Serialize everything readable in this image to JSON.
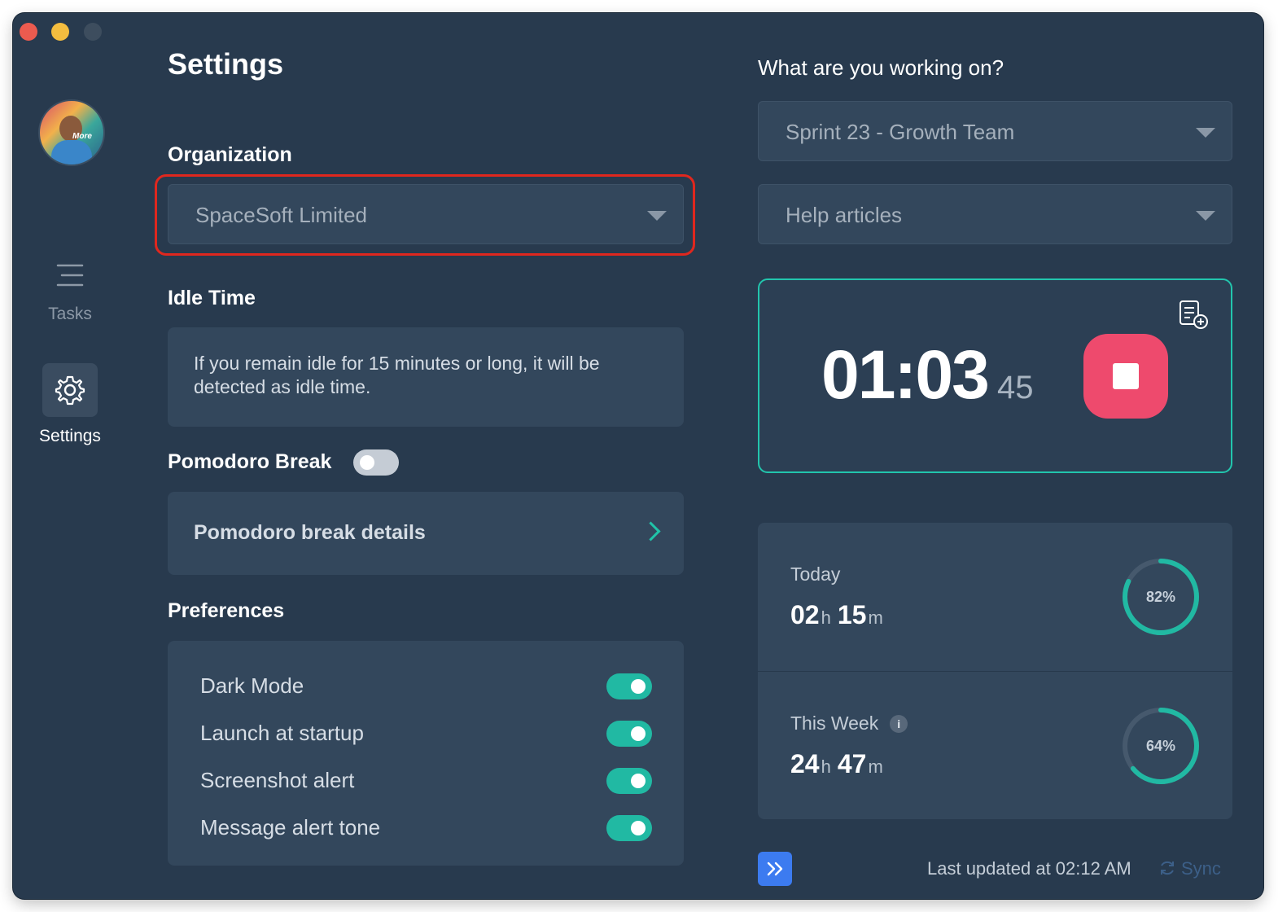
{
  "window": {
    "controls": [
      "close",
      "minimize",
      "disabled"
    ]
  },
  "sidebar": {
    "avatar_tag": "More",
    "items": [
      {
        "label": "Tasks",
        "icon": "list-icon",
        "active": false
      },
      {
        "label": "Settings",
        "icon": "gear-icon",
        "active": true
      }
    ]
  },
  "settings": {
    "title": "Settings",
    "organization": {
      "label": "Organization",
      "value": "SpaceSoft Limited"
    },
    "idle_time": {
      "label": "Idle Time",
      "text": "If you remain idle for 15 minutes or long, it will be detected as idle time."
    },
    "pomodoro": {
      "label": "Pomodoro Break",
      "enabled": false,
      "details_label": "Pomodoro break details"
    },
    "preferences": {
      "label": "Preferences",
      "items": [
        {
          "label": "Dark Mode",
          "enabled": true
        },
        {
          "label": "Launch at startup",
          "enabled": true
        },
        {
          "label": "Screenshot alert",
          "enabled": true
        },
        {
          "label": "Message alert tone",
          "enabled": true
        }
      ]
    }
  },
  "tracker": {
    "prompt": "What are you working on?",
    "project": "Sprint 23 - Growth Team",
    "task": "Help articles",
    "timer": {
      "main": "01:03",
      "seconds": "45"
    },
    "stats": [
      {
        "label": "Today",
        "hours": "02",
        "hours_unit": "h",
        "minutes": "15",
        "minutes_unit": "m",
        "percent": 82,
        "percent_label": "82%"
      },
      {
        "label": "This Week",
        "hours": "24",
        "hours_unit": "h",
        "minutes": "47",
        "minutes_unit": "m",
        "percent": 64,
        "percent_label": "64%",
        "info": "i"
      }
    ],
    "last_updated": "Last updated at 02:12 AM",
    "sync_label": "Sync"
  },
  "colors": {
    "background": "#283a4e",
    "panel": "#33475c",
    "accent": "#21b9a3",
    "stop": "#ee4a6d",
    "highlight": "#e0271e",
    "expand": "#3c7bf0"
  }
}
